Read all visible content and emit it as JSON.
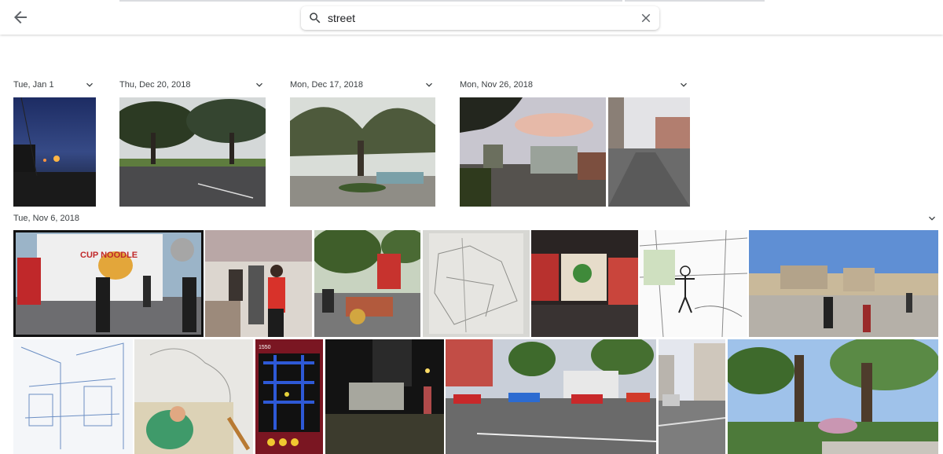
{
  "search": {
    "query": "street"
  },
  "icons": {
    "back": "arrow-left-icon",
    "search": "magnifier-icon",
    "clear": "close-icon",
    "expand": "chevron-down-icon"
  },
  "sections": [
    {
      "date": "Tue, Jan 1"
    },
    {
      "date": "Thu, Dec 20, 2018"
    },
    {
      "date": "Mon, Dec 17, 2018"
    },
    {
      "date": "Mon, Nov 26, 2018"
    },
    {
      "date": "Tue, Nov 6, 2018"
    }
  ],
  "thumb_texts": {
    "truck_brand": "CUP NOODLE",
    "phone_score": "1550"
  }
}
